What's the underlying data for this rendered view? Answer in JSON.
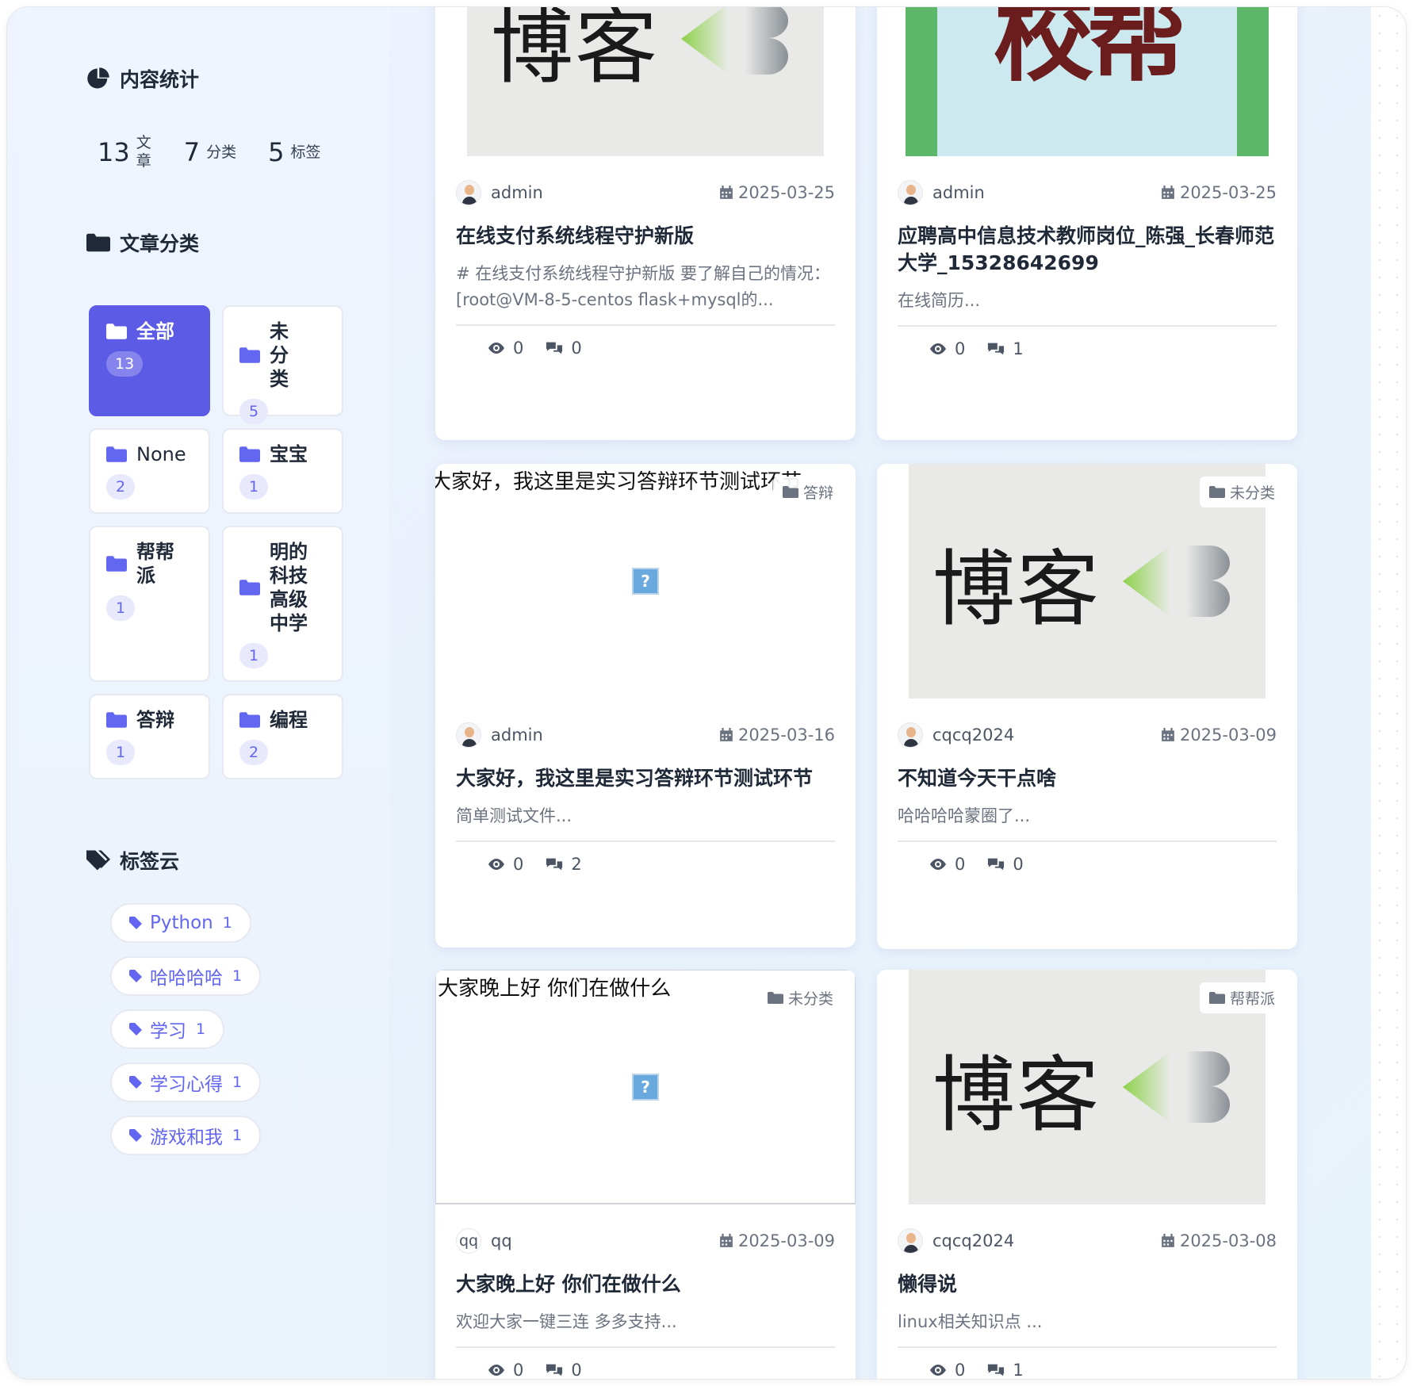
{
  "sidebar": {
    "stats_heading": "内容统计",
    "stats": [
      {
        "num": "13",
        "label": "文章"
      },
      {
        "num": "7",
        "label": "分类"
      },
      {
        "num": "5",
        "label": "标签"
      }
    ],
    "categories_heading": "文章分类",
    "categories": [
      {
        "name": "全部",
        "count": "13",
        "active": true
      },
      {
        "name": "未分类",
        "count": "5"
      },
      {
        "name": "None",
        "count": "2"
      },
      {
        "name": "宝宝",
        "count": "1"
      },
      {
        "name": "帮帮派",
        "count": "1"
      },
      {
        "name": "明的科技高级中学",
        "count": "1"
      },
      {
        "name": "答辩",
        "count": "1"
      },
      {
        "name": "编程",
        "count": "2"
      }
    ],
    "tags_heading": "标签云",
    "tags": [
      {
        "name": "Python",
        "count": "1"
      },
      {
        "name": "哈哈哈哈",
        "count": "1"
      },
      {
        "name": "学习",
        "count": "1"
      },
      {
        "name": "学习心得",
        "count": "1"
      },
      {
        "name": "游戏和我",
        "count": "1"
      }
    ]
  },
  "posts": [
    {
      "author": "admin",
      "date": "2025-03-25",
      "title": "在线支付系统线程守护新版",
      "excerpt": "# 在线支付系统线程守护新版 要了解自己的情况： [root@VM-8-5-centos flask+mysql的...",
      "views": "0",
      "comments": "0",
      "thumb_text": "博客"
    },
    {
      "author": "admin",
      "date": "2025-03-25",
      "title": "应聘高中信息技术教师岗位_陈强_长春师范大学_15328642699",
      "excerpt": "在线简历...",
      "views": "0",
      "comments": "1",
      "thumb_text": "校帮"
    },
    {
      "author": "admin",
      "date": "2025-03-16",
      "title": "大家好，我这里是实习答辩环节测试环节",
      "excerpt": "简单测试文件...",
      "views": "0",
      "comments": "2",
      "category": "答辩",
      "img_alt": "大家好，我这里是实习答辩环节测试环节"
    },
    {
      "author": "cqcq2024",
      "date": "2025-03-09",
      "title": "不知道今天干点啥",
      "excerpt": "哈哈哈哈蒙圈了...",
      "views": "0",
      "comments": "0",
      "category": "未分类",
      "thumb_text": "博客"
    },
    {
      "author": "qq",
      "avatar_text": "qq",
      "date": "2025-03-09",
      "title": "大家晚上好 你们在做什么",
      "excerpt": "欢迎大家一键三连 多多支持...",
      "views": "0",
      "comments": "0",
      "category": "未分类",
      "img_alt": "大家晚上好 你们在做什么"
    },
    {
      "author": "cqcq2024",
      "date": "2025-03-08",
      "title": "懒得说",
      "excerpt": "linux相关知识点 ...",
      "views": "0",
      "comments": "1",
      "category": "帮帮派",
      "thumb_text": "博客"
    }
  ],
  "broken_image_glyph": "?",
  "colors": {
    "accent": "#5b5be6",
    "tag": "#6366f1"
  }
}
